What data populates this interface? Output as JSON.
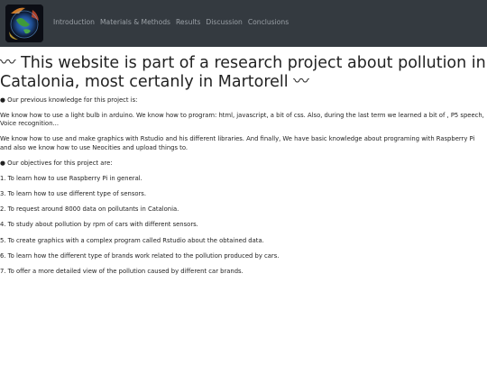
{
  "nav": {
    "logo": "site-logo",
    "links": [
      "Introduction",
      "Materials & Methods",
      "Results",
      "Discussion",
      "Conclusions"
    ]
  },
  "headline": "〰 This website is part of a research project about pollution in Catalonia, most certanly in Martorell 〰",
  "knowledge_heading": "● Our previous knowledge for this project is:",
  "knowledge_p1": "We know how to use a light bulb in arduino. We know how to program: html, javascript, a bit of css. Also, during the last term we learned a bit of , P5 speech, Voice recognition...",
  "knowledge_p2": "We know how to use and make graphics with Rstudio and his different libraries. And finally, We have basic knowledge about programing with Raspberry Pi and also we know how to use Neocities and upload things to.",
  "objectives_heading": "● Our objectives for this project are:",
  "objectives": [
    "1. To learn how to use Raspberry Pi in general.",
    "3. To learn how to use different type of sensors.",
    "2. To request around 8000 data on pollutants in Catalonia.",
    "4. To study about pollution by rpm of cars with different sensors.",
    "5. To create graphics with a complex program called Rstudio about the obtained data.",
    "6. To learn how the different type of brands work related to the pollution produced by cars.",
    "7. To offer a more detailed view of the pollution caused by different car brands."
  ]
}
